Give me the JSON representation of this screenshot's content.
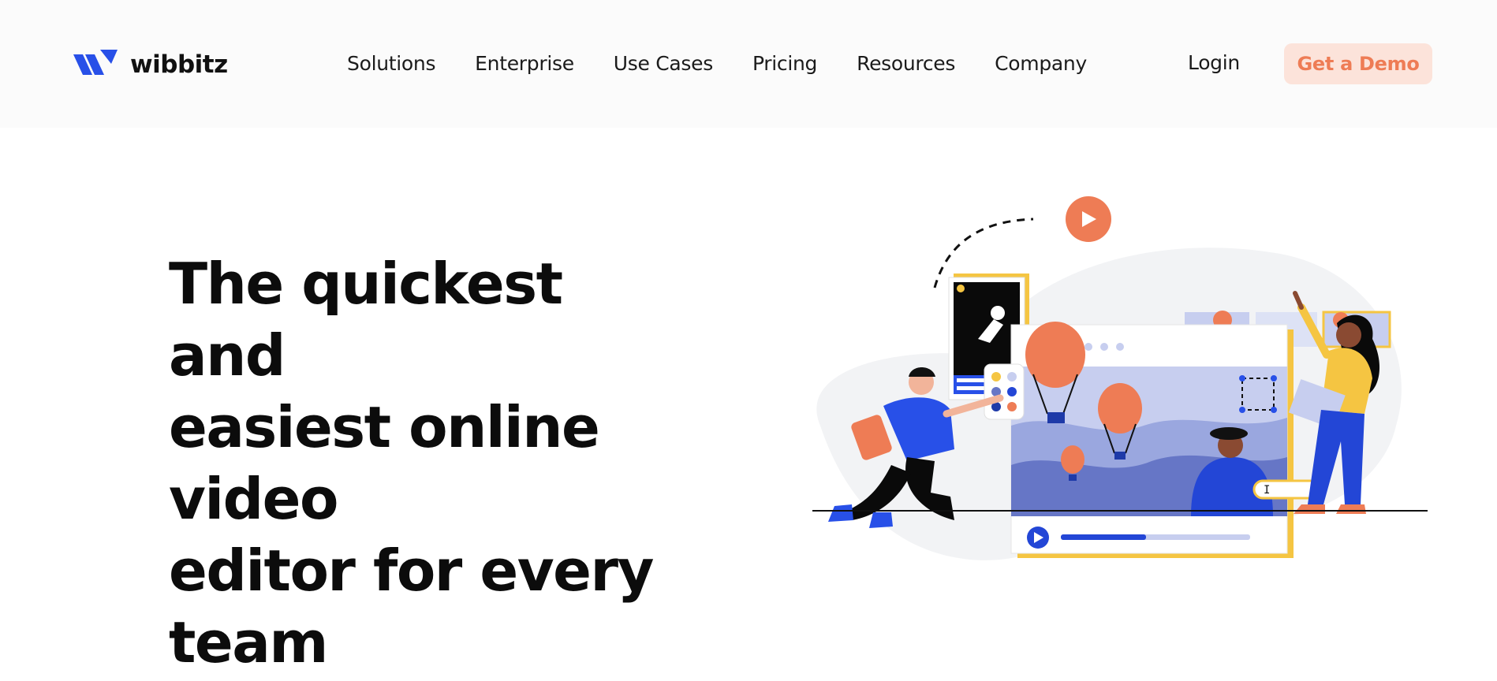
{
  "brand": {
    "name": "wibbitz",
    "color": "#2850e8"
  },
  "nav": {
    "items": [
      {
        "label": "Solutions"
      },
      {
        "label": "Enterprise"
      },
      {
        "label": "Use Cases"
      },
      {
        "label": "Pricing"
      },
      {
        "label": "Resources"
      },
      {
        "label": "Company"
      }
    ],
    "login_label": "Login",
    "demo_label": "Get a Demo"
  },
  "hero": {
    "title_lines": [
      "The quickest",
      "and",
      "easiest online",
      "video",
      "editor for every",
      "team"
    ]
  },
  "colors": {
    "accent_orange": "#ee7c55",
    "demo_button_bg": "#fce3da",
    "brand_blue": "#2850e8",
    "illustration_yellow": "#f5c542",
    "blob_gray": "#f2f3f5"
  },
  "illustration": {
    "icons": [
      "play-icon",
      "hot-air-balloon-icon",
      "astronaut-icon",
      "cursor-icon"
    ],
    "progress": 0.45
  }
}
